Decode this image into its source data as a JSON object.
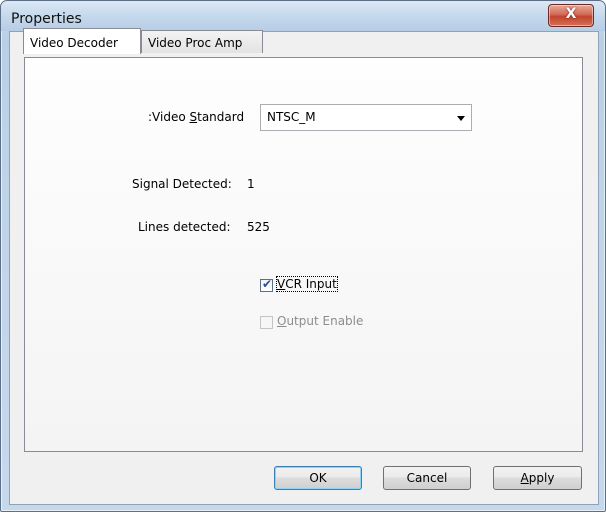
{
  "window": {
    "title": "Properties",
    "close_label": "X"
  },
  "tabs": [
    {
      "label": "Video Decoder",
      "active": true
    },
    {
      "label": "Video Proc Amp",
      "active": false
    }
  ],
  "decoder": {
    "video_standard": {
      "label_prefix": ":Video ",
      "label_mnemonic": "S",
      "label_suffix": "tandard",
      "value": "NTSC_M"
    },
    "signal_detected": {
      "label": "Signal Detected:",
      "value": "1"
    },
    "lines_detected": {
      "label": "Lines detected:",
      "value": "525"
    },
    "vcr_input": {
      "mnemonic": "V",
      "label_rest": "CR Input",
      "checked": true,
      "enabled": true
    },
    "output_enable": {
      "mnemonic": "O",
      "label_rest": "utput Enable",
      "checked": false,
      "enabled": false
    }
  },
  "buttons": {
    "ok": "OK",
    "cancel": "Cancel",
    "apply_mnemonic": "A",
    "apply_rest": "pply"
  },
  "colors": {
    "frame": "#c6d8ec",
    "close_button": "#c2442c",
    "check_mark": "#2a4d9f"
  }
}
